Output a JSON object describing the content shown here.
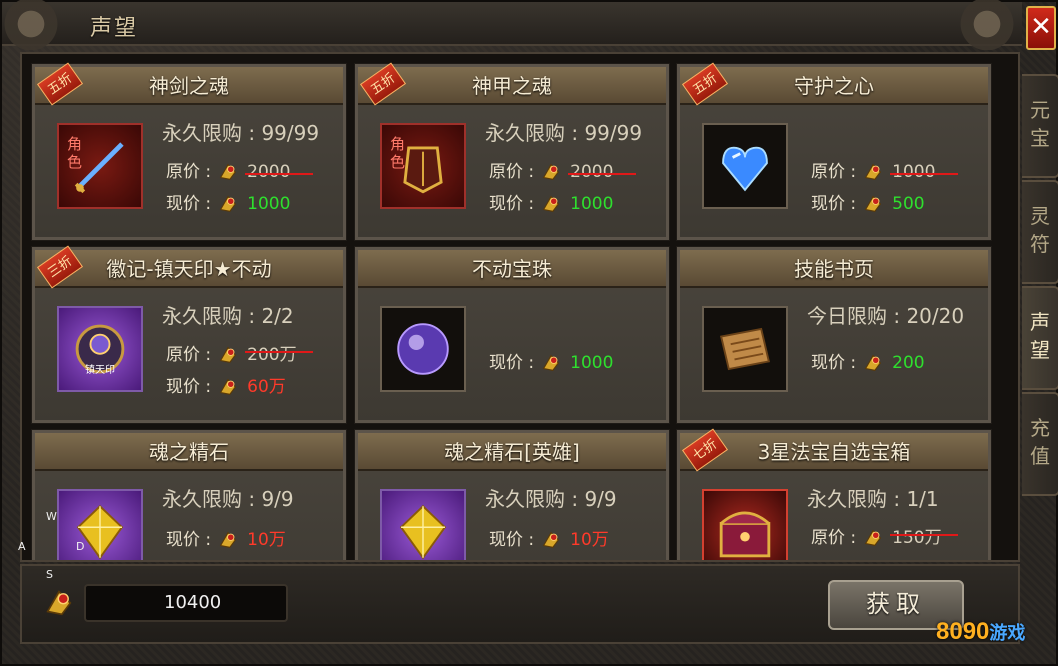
{
  "window": {
    "title": "声望",
    "close_label": "✕"
  },
  "tabs": [
    {
      "label": "元宝",
      "active": false
    },
    {
      "label": "灵符",
      "active": false
    },
    {
      "label": "声望",
      "active": true
    },
    {
      "label": "充值",
      "active": false
    }
  ],
  "labels": {
    "orig": "原价 :",
    "cur": "现价 :"
  },
  "items": [
    {
      "name": "神剑之魂",
      "discount": "五折",
      "limit": "永久限购 : 99/99",
      "orig": "2000",
      "cur": "1000",
      "cur_color": "green",
      "tag": "角色",
      "icon": "sword-icon",
      "box": "red"
    },
    {
      "name": "神甲之魂",
      "discount": "五折",
      "limit": "永久限购 : 99/99",
      "orig": "2000",
      "cur": "1000",
      "cur_color": "green",
      "tag": "角色",
      "icon": "armor-icon",
      "box": "red"
    },
    {
      "name": "守护之心",
      "discount": "五折",
      "limit": "",
      "orig": "1000",
      "cur": "500",
      "cur_color": "green",
      "tag": "",
      "icon": "heart-gem-icon",
      "box": "dark"
    },
    {
      "name": "徽记-镇天印★不动",
      "discount": "三折",
      "limit": "永久限购 : 2/2",
      "orig": "200万",
      "cur": "60万",
      "cur_color": "red",
      "tag": "",
      "icon": "seal-icon",
      "icon_text": "镇天印",
      "box": "purple"
    },
    {
      "name": "不动宝珠",
      "discount": "",
      "limit": "",
      "orig": "",
      "cur": "1000",
      "cur_color": "green",
      "tag": "",
      "icon": "orb-icon",
      "box": "dark"
    },
    {
      "name": "技能书页",
      "discount": "",
      "limit": "今日限购 : 20/20",
      "orig": "",
      "cur": "200",
      "cur_color": "green",
      "tag": "",
      "icon": "scroll-icon",
      "box": "dark"
    },
    {
      "name": "魂之精石",
      "discount": "",
      "limit": "永久限购 : 9/9",
      "orig": "",
      "cur": "10万",
      "cur_color": "red",
      "tag": "",
      "icon": "gem-icon",
      "box": "purple"
    },
    {
      "name": "魂之精石[英雄]",
      "discount": "",
      "limit": "永久限购 : 9/9",
      "orig": "",
      "cur": "10万",
      "cur_color": "red",
      "tag": "",
      "icon": "gem-icon",
      "box": "purple"
    },
    {
      "name": "3星法宝自选宝箱",
      "discount": "七折",
      "limit": "永久限购 : 1/1",
      "orig": "150万",
      "cur": "",
      "cur_color": "green",
      "tag": "",
      "icon": "chest-icon",
      "box": "gold-red"
    }
  ],
  "wallet": {
    "amount": "10400",
    "icon": "reputation-coin-icon"
  },
  "get_button": "获取",
  "wasd": {
    "w": "W",
    "a": "A",
    "s": "S",
    "d": "D"
  },
  "watermark": {
    "text": "8090",
    "suffix": "游戏"
  }
}
